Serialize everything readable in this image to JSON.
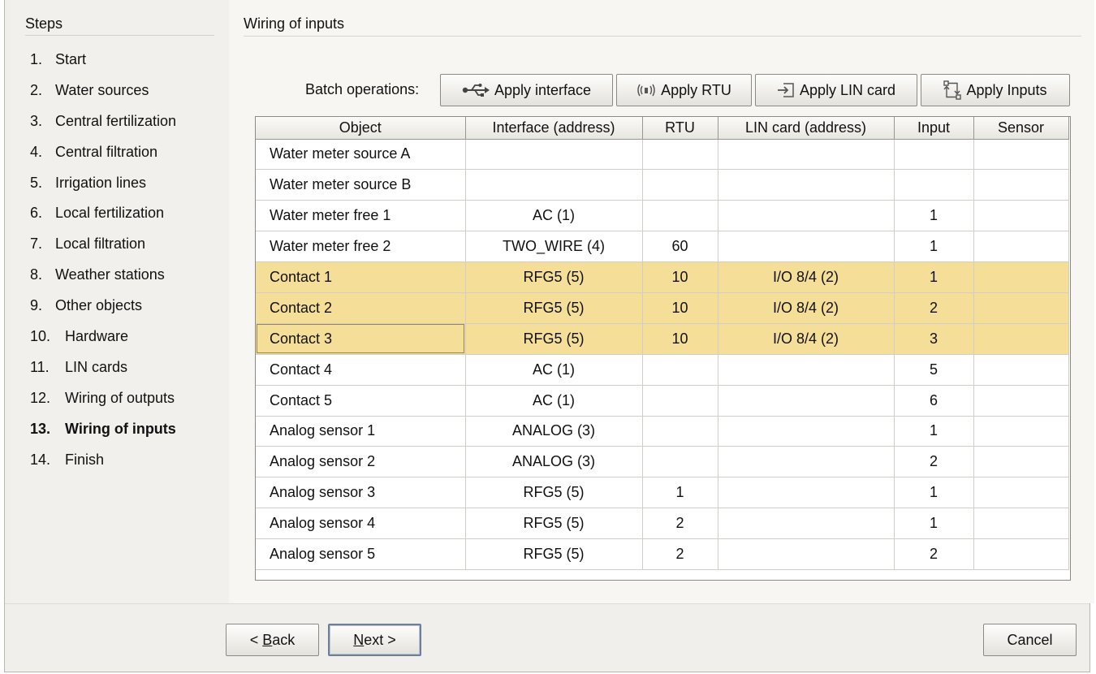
{
  "sidebar": {
    "title": "Steps",
    "steps": [
      {
        "num": "1.",
        "label": "Start"
      },
      {
        "num": "2.",
        "label": "Water sources"
      },
      {
        "num": "3.",
        "label": "Central fertilization"
      },
      {
        "num": "4.",
        "label": "Central filtration"
      },
      {
        "num": "5.",
        "label": "Irrigation lines"
      },
      {
        "num": "6.",
        "label": "Local fertilization"
      },
      {
        "num": "7.",
        "label": "Local filtration"
      },
      {
        "num": "8.",
        "label": "Weather stations"
      },
      {
        "num": "9.",
        "label": "Other objects"
      },
      {
        "num": "10.",
        "label": "Hardware"
      },
      {
        "num": "11.",
        "label": "LIN cards"
      },
      {
        "num": "12.",
        "label": "Wiring of outputs"
      },
      {
        "num": "13.",
        "label": "Wiring of inputs"
      },
      {
        "num": "14.",
        "label": "Finish"
      }
    ],
    "current_step": "13."
  },
  "main": {
    "title": "Wiring of inputs",
    "batch_label": "Batch operations:",
    "buttons": {
      "apply_interface": {
        "label": "Apply interface",
        "icon": "usb-icon"
      },
      "apply_rtu": {
        "label": "Apply RTU",
        "icon": "radio-waves-icon"
      },
      "apply_lin_card": {
        "label": "Apply LIN card",
        "icon": "card-insert-icon"
      },
      "apply_inputs": {
        "label": "Apply Inputs",
        "icon": "connect-arrows-icon"
      }
    }
  },
  "table": {
    "columns": [
      "Object",
      "Interface (address)",
      "RTU",
      "LIN card (address)",
      "Input",
      "Sensor"
    ],
    "rows": [
      [
        "Water meter source A",
        "",
        "",
        "",
        "",
        ""
      ],
      [
        "Water meter source B",
        "",
        "",
        "",
        "",
        ""
      ],
      [
        "Water meter free 1",
        "AC (1)",
        "",
        "",
        "1",
        ""
      ],
      [
        "Water meter free 2",
        "TWO_WIRE (4)",
        "60",
        "",
        "1",
        ""
      ],
      [
        "Contact 1",
        "RFG5 (5)",
        "10",
        "I/O 8/4 (2)",
        "1",
        ""
      ],
      [
        "Contact 2",
        "RFG5 (5)",
        "10",
        "I/O 8/4 (2)",
        "2",
        ""
      ],
      [
        "Contact 3",
        "RFG5 (5)",
        "10",
        "I/O 8/4 (2)",
        "3",
        ""
      ],
      [
        "Contact 4",
        "AC (1)",
        "",
        "",
        "5",
        ""
      ],
      [
        "Contact 5",
        "AC (1)",
        "",
        "",
        "6",
        ""
      ],
      [
        "Analog sensor 1",
        "ANALOG (3)",
        "",
        "",
        "1",
        ""
      ],
      [
        "Analog sensor 2",
        "ANALOG (3)",
        "",
        "",
        "2",
        ""
      ],
      [
        "Analog sensor 3",
        "RFG5 (5)",
        "1",
        "",
        "1",
        ""
      ],
      [
        "Analog sensor 4",
        "RFG5 (5)",
        "2",
        "",
        "1",
        ""
      ],
      [
        "Analog sensor 5",
        "RFG5 (5)",
        "2",
        "",
        "2",
        ""
      ]
    ],
    "selected_rows": [
      "Contact 1",
      "Contact 2",
      "Contact 3"
    ],
    "focused_row": "Contact 3",
    "selection_color": "#f5df98"
  },
  "footer": {
    "back": {
      "prefix": "< ",
      "mnemonic": "B",
      "rest": "ack"
    },
    "next": {
      "mnemonic": "N",
      "rest": "ext >"
    },
    "cancel": "Cancel"
  }
}
